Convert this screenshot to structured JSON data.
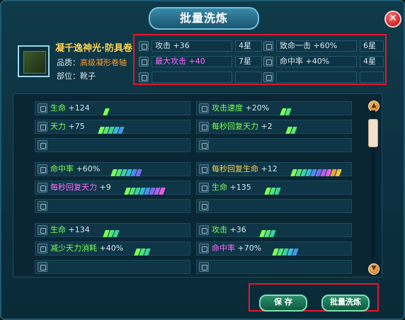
{
  "window": {
    "title": "批量洗炼",
    "close_glyph": "✕"
  },
  "item": {
    "name": "凝千逸神光·防具卷",
    "quality_label": "品质：",
    "quality_value": "高级凝形卷轴",
    "slot_label": "部位：",
    "slot_value": "靴子"
  },
  "current_attrs": [
    [
      {
        "name": "攻击 +36",
        "star": "4星",
        "color": "#d8e6ee"
      },
      {
        "name": "致命一击 +60%",
        "star": "6星",
        "color": "#d8e6ee"
      }
    ],
    [
      {
        "name": "最大攻击 +40",
        "star": "7星",
        "color": "#ff6aff"
      },
      {
        "name": "命中率 +40%",
        "star": "4星",
        "color": "#d8e6ee"
      }
    ],
    [
      {
        "name": "",
        "star": "",
        "color": "#d8e6ee"
      },
      {
        "name": "",
        "star": "",
        "color": "#d8e6ee"
      }
    ]
  ],
  "groups": [
    [
      [
        {
          "name": "生命",
          "value": "+124",
          "color": "#7dff57",
          "bars": 1
        },
        {
          "name": "攻击速度",
          "value": "+20%",
          "color": "#7dff57",
          "bars": 2
        }
      ],
      [
        {
          "name": "天力",
          "value": "+75",
          "color": "#7dff57",
          "bars": 5
        },
        {
          "name": "每秒回复天力",
          "value": "+2",
          "color": "#7dff57",
          "bars": 2
        }
      ],
      [
        {
          "name": "",
          "value": "",
          "color": "#d8e6ee",
          "bars": 0
        },
        {
          "name": "",
          "value": "",
          "color": "#d8e6ee",
          "bars": 0
        }
      ]
    ],
    [
      [
        {
          "name": "命中率",
          "value": "+60%",
          "color": "#7dff57",
          "bars": 6
        },
        {
          "name": "每秒回复生命",
          "value": "+12",
          "color": "#ffd24a",
          "bars": 10
        }
      ],
      [
        {
          "name": "每秒回复天力",
          "value": "+9",
          "color": "#ff6aff",
          "bars": 8
        },
        {
          "name": "生命",
          "value": "+135",
          "color": "#7dff57",
          "bars": 3
        }
      ],
      [
        {
          "name": "",
          "value": "",
          "color": "#d8e6ee",
          "bars": 0
        },
        {
          "name": "",
          "value": "",
          "color": "#d8e6ee",
          "bars": 0
        }
      ]
    ],
    [
      [
        {
          "name": "生命",
          "value": "+134",
          "color": "#7dff57",
          "bars": 3
        },
        {
          "name": "攻击",
          "value": "+36",
          "color": "#7dff57",
          "bars": 3
        }
      ],
      [
        {
          "name": "减少天力消耗",
          "value": "+40%",
          "color": "#7dff57",
          "bars": 3
        },
        {
          "name": "命中率",
          "value": "+70%",
          "color": "#ff6aff",
          "bars": 5
        }
      ],
      [
        {
          "name": "",
          "value": "",
          "color": "#d8e6ee",
          "bars": 0
        },
        {
          "name": "",
          "value": "",
          "color": "#d8e6ee",
          "bars": 0
        }
      ]
    ]
  ],
  "buttons": {
    "save": "保 存",
    "batch": "批量洗炼"
  },
  "colors": {
    "accent": "#6fc3df",
    "highlight_box": "#e8152a"
  }
}
